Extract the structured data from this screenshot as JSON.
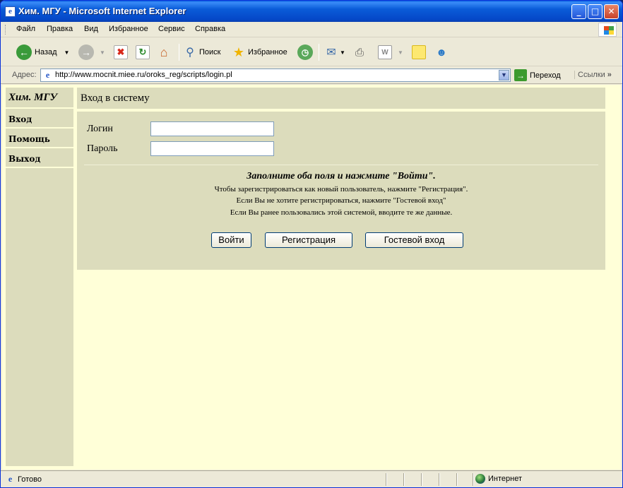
{
  "window": {
    "title": "Хим. МГУ - Microsoft Internet Explorer"
  },
  "menubar": {
    "items": [
      "Файл",
      "Правка",
      "Вид",
      "Избранное",
      "Сервис",
      "Справка"
    ]
  },
  "toolbar": {
    "back_label": "Назад",
    "search_label": "Поиск",
    "favorites_label": "Избранное"
  },
  "address": {
    "label": "Адрес:",
    "url": "http://www.mocnit.miee.ru/oroks_reg/scripts/login.pl",
    "go_label": "Переход",
    "links_label": "Ссылки"
  },
  "sidebar": {
    "header": "Хим. МГУ",
    "items": [
      "Вход",
      "Помощь",
      "Выход"
    ]
  },
  "main": {
    "title": "Вход в систему",
    "login_label": "Логин",
    "password_label": "Пароль",
    "login_value": "",
    "password_value": "",
    "hint_main": "Заполните оба поля и нажмите \"Войти\".",
    "hints": [
      "Чтобы зарегистрироваться как новый пользователь, нажмите \"Регистрация\".",
      "Если Вы не хотите регистрироваться, нажмите \"Гостевой вход\"",
      "Если Вы ранее пользовались этой системой, вводите те же данные."
    ],
    "buttons": {
      "login": "Войти",
      "register": "Регистрация",
      "guest": "Гостевой вход"
    }
  },
  "statusbar": {
    "text": "Готово",
    "zone": "Интернет"
  },
  "colors": {
    "page_bg": "#ffffd8",
    "panel_bg": "#dcdcbc",
    "titlebar": "#0548c8"
  }
}
